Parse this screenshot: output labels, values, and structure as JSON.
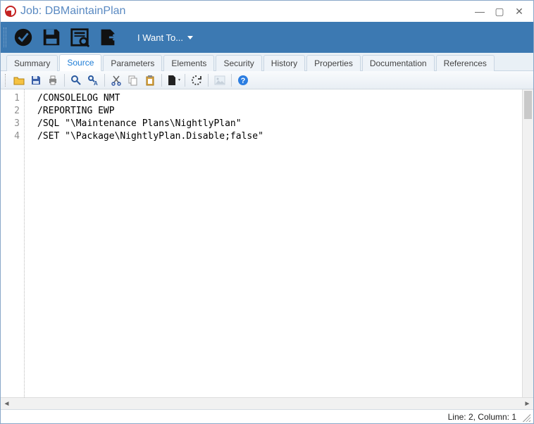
{
  "window": {
    "title": "Job: DBMaintainPlan"
  },
  "iwant_label": "I Want To...",
  "tabs": [
    {
      "label": "Summary"
    },
    {
      "label": "Source"
    },
    {
      "label": "Parameters"
    },
    {
      "label": "Elements"
    },
    {
      "label": "Security"
    },
    {
      "label": "History"
    },
    {
      "label": "Properties"
    },
    {
      "label": "Documentation"
    },
    {
      "label": "References"
    }
  ],
  "active_tab": "Source",
  "editor_icons": [
    "open-icon",
    "save-icon",
    "print-icon",
    "find-icon",
    "find-replace-icon",
    "cut-icon",
    "copy-icon",
    "paste-icon",
    "new-doc-icon",
    "refresh-icon",
    "image-icon",
    "help-icon"
  ],
  "source_lines": [
    {
      "n": "1",
      "text": "/CONSOLELOG NMT"
    },
    {
      "n": "2",
      "text": "/REPORTING EWP"
    },
    {
      "n": "3",
      "text": "/SQL \"\\Maintenance Plans\\NightlyPlan\""
    },
    {
      "n": "4",
      "text": "/SET \"\\Package\\NightlyPlan.Disable;false\""
    }
  ],
  "status": {
    "position": "Line: 2, Column: 1"
  }
}
